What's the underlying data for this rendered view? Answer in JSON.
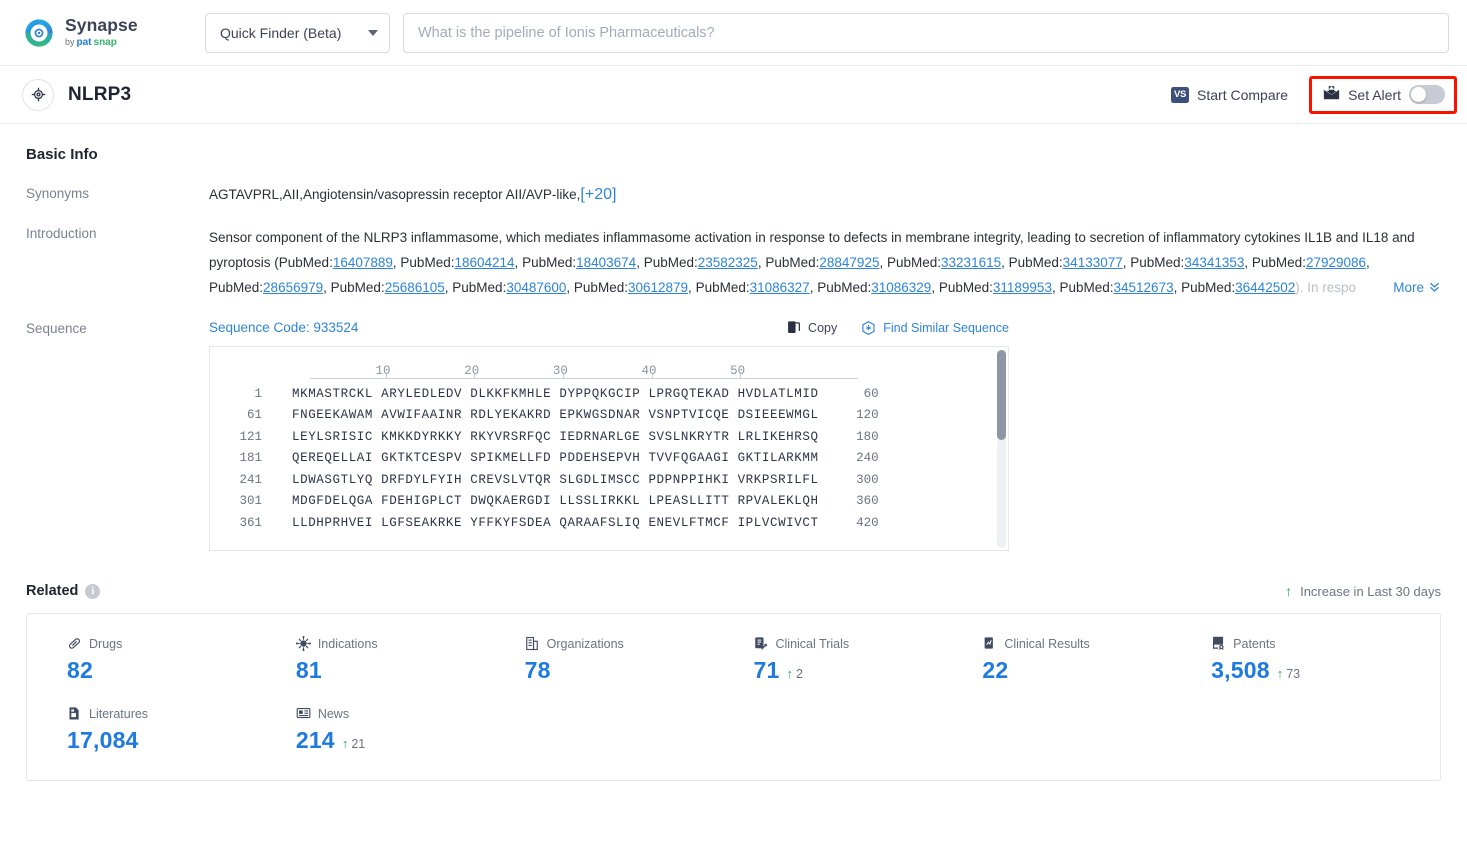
{
  "brand": {
    "name": "Synapse",
    "by": "by",
    "pats": "pat",
    "snap": "snap"
  },
  "topbar": {
    "finder_label": "Quick Finder (Beta)",
    "search_placeholder": "What is the pipeline of Ionis Pharmaceuticals?"
  },
  "entity": {
    "name": "NLRP3",
    "compare_label": "Start Compare",
    "compare_badge": "VS",
    "alert_label": "Set Alert",
    "alert_on": false,
    "highlight_color": "#fb1100"
  },
  "basic_info": {
    "title": "Basic Info",
    "synonyms_label": "Synonyms",
    "synonyms_value": "AGTAVPRL,AII,Angiotensin/vasopressin receptor AII/AVP-like,",
    "synonyms_more": "[+20]",
    "introduction_label": "Introduction",
    "introduction_lead": "Sensor component of the NLRP3 inflammasome, which mediates inflammasome activation in response to defects in membrane integrity, leading to secretion of inflammatory cytokines IL1B and IL18 and pyroptosis (",
    "pubmed_prefix": "PubMed:",
    "pubmed_ids": [
      "16407889",
      "18604214",
      "18403674",
      "23582325",
      "28847925",
      "33231615",
      "34133077",
      "34341353",
      "27929086",
      "28656979",
      "25686105",
      "30487600",
      "30612879",
      "31086327",
      "31086329",
      "31189953",
      "34512673",
      "36442502"
    ],
    "introduction_tail": "). In respo",
    "more_label": "More",
    "more_icon": "chevron-double-down"
  },
  "sequence": {
    "label": "Sequence",
    "code_label": "Sequence Code: 933524",
    "copy_label": "Copy",
    "similar_label": "Find Similar Sequence",
    "ruler_ticks": [
      10,
      20,
      30,
      40,
      50
    ],
    "rows": [
      {
        "start": "1",
        "letters": "MKMASTRCKL ARYLEDLEDV DLKKFKMHLE DYPPQKGCIP LPRGQTEKAD HVDLATLMID",
        "end": "60"
      },
      {
        "start": "61",
        "letters": "FNGEEKAWAM AVWIFAAINR RDLYEKAKRD EPKWGSDNAR VSNPTVICQE DSIEEEWMGL",
        "end": "120"
      },
      {
        "start": "121",
        "letters": "LEYLSRISIC KMKKDYRKKY RKYVRSRFQC IEDRNARLGE SVSLNKRYTR LRLIKEHRSQ",
        "end": "180"
      },
      {
        "start": "181",
        "letters": "QEREQELLAI GKTKTCESPV SPIKMELLFD PDDEHSEPVH TVVFQGAAGI GKTILARKMM",
        "end": "240"
      },
      {
        "start": "241",
        "letters": "LDWASGTLYQ DRFDYLFYIH CREVSLVTQR SLGDLIMSCC PDPNPPIHKI VRKPSRILFL",
        "end": "300"
      },
      {
        "start": "301",
        "letters": "MDGFDELQGA FDEHIGPLCT DWQKAERGDI LLSSLIRKKL LPEASLLITT RPVALEKLQH",
        "end": "360"
      },
      {
        "start": "361",
        "letters": "LLDHPRHVEI LGFSEAKRKE YFFKYFSDEA QARAAFSLIQ ENEVLFTMCF IPLVCWIVCT",
        "end": "420"
      }
    ]
  },
  "related": {
    "title": "Related",
    "info_glyph": "i",
    "legend": "Increase in Last 30 days",
    "legend_arrow": "↑",
    "stats": [
      {
        "icon": "pill-icon",
        "label": "Drugs",
        "value": "82",
        "delta": null
      },
      {
        "icon": "virus-icon",
        "label": "Indications",
        "value": "81",
        "delta": null
      },
      {
        "icon": "building-icon",
        "label": "Organizations",
        "value": "78",
        "delta": null
      },
      {
        "icon": "clinical-trial-icon",
        "label": "Clinical Trials",
        "value": "71",
        "delta": "2"
      },
      {
        "icon": "clinical-result-icon",
        "label": "Clinical Results",
        "value": "22",
        "delta": null
      },
      {
        "icon": "patent-icon",
        "label": "Patents",
        "value": "3,508",
        "delta": "73"
      },
      {
        "icon": "literature-icon",
        "label": "Literatures",
        "value": "17,084",
        "delta": null
      },
      {
        "icon": "news-icon",
        "label": "News",
        "value": "214",
        "delta": "21"
      }
    ]
  },
  "colors": {
    "accent_blue": "#1f7ae0",
    "link_blue": "#2e84d8",
    "green": "#2bab4b",
    "alert_red": "#fb1100"
  }
}
